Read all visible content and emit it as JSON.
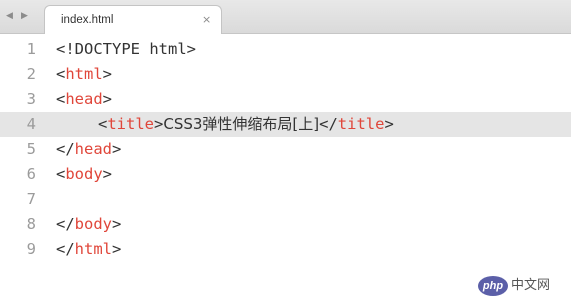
{
  "tabbar": {
    "back_glyph": "◀",
    "forward_glyph": "▶",
    "tab_label": "index.html",
    "close_glyph": "×"
  },
  "editor": {
    "active_line": 4,
    "lines": [
      {
        "num": "1",
        "open": "<!DOCTYPE html>"
      },
      {
        "num": "2",
        "open": "<",
        "tag": "html",
        "close": ">"
      },
      {
        "num": "3",
        "open": "<",
        "tag": "head",
        "close": ">"
      },
      {
        "num": "4",
        "open": "<",
        "tag": "title",
        "close": ">",
        "text": "CSS3弹性伸缩布局[上]",
        "open2": "</",
        "tag2": "title",
        "close2": ">"
      },
      {
        "num": "5",
        "open": "</",
        "tag": "head",
        "close": ">"
      },
      {
        "num": "6",
        "open": "<",
        "tag": "body",
        "close": ">"
      },
      {
        "num": "7"
      },
      {
        "num": "8",
        "open": "</",
        "tag": "body",
        "close": ">"
      },
      {
        "num": "9",
        "open": "</",
        "tag": "html",
        "close": ">"
      }
    ]
  },
  "watermark": {
    "badge": "php",
    "text": "中文网"
  }
}
